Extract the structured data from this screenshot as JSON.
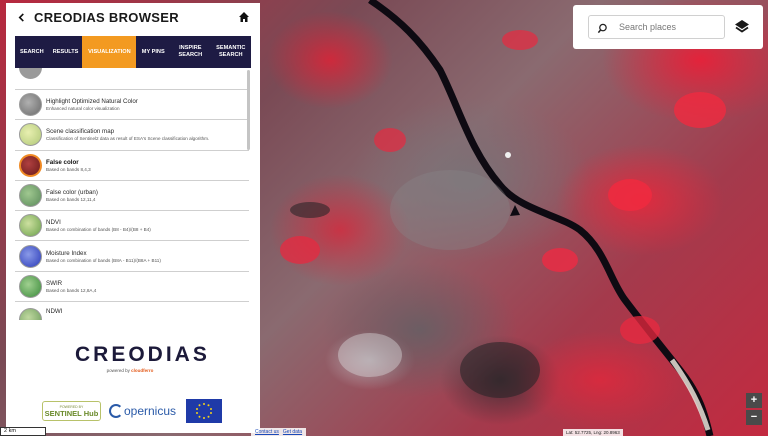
{
  "app": {
    "title": "CREODIAS BROWSER"
  },
  "tabs": [
    {
      "label": "SEARCH"
    },
    {
      "label": "RESULTS"
    },
    {
      "label": "VISUALIZATION"
    },
    {
      "label": "MY PINS"
    },
    {
      "label": "INSPIRE SEARCH"
    },
    {
      "label": "SEMANTIC SEARCH"
    }
  ],
  "visualizations": [
    {
      "name": "Highlight Optimized Natural Color",
      "desc": "Enhanced natural color visualization"
    },
    {
      "name": "Scene classification map",
      "desc": "Classification of Sentinel2 data as result of ESA's Scene classification algorithm."
    },
    {
      "name": "False color",
      "desc": "Based on bands 8,4,3"
    },
    {
      "name": "False color (urban)",
      "desc": "Based on bands 12,11,4"
    },
    {
      "name": "NDVI",
      "desc": "Based on combination of bands (B8 - B4)/(B8 + B4)"
    },
    {
      "name": "Moisture Index",
      "desc": "Based on combination of bands (B8A - B11)/(B8A + B11)"
    },
    {
      "name": "SWIR",
      "desc": "Based on bands 12,8A,4"
    },
    {
      "name": "NDWI",
      "desc": ""
    }
  ],
  "colors": {
    "tab_bar": "#1e1b44",
    "tab_active": "#f39a21",
    "selected_ring": "#f08a24"
  },
  "branding": {
    "logo": "CREODIAS",
    "powered_prefix": "powered by",
    "powered_brand": "cloudferro",
    "sentinel_top": "POWERED BY",
    "sentinel_main": "SENTINEL Hub",
    "copernicus": "opernicus"
  },
  "search": {
    "placeholder": "Search places"
  },
  "map": {
    "scale": "2 km",
    "attrib_contact": "Contact us",
    "attrib_get_data": "Get data",
    "coords": "Lat: 52.7725, Lng: 20.8963"
  },
  "zoom": {
    "in": "+",
    "out": "−"
  }
}
